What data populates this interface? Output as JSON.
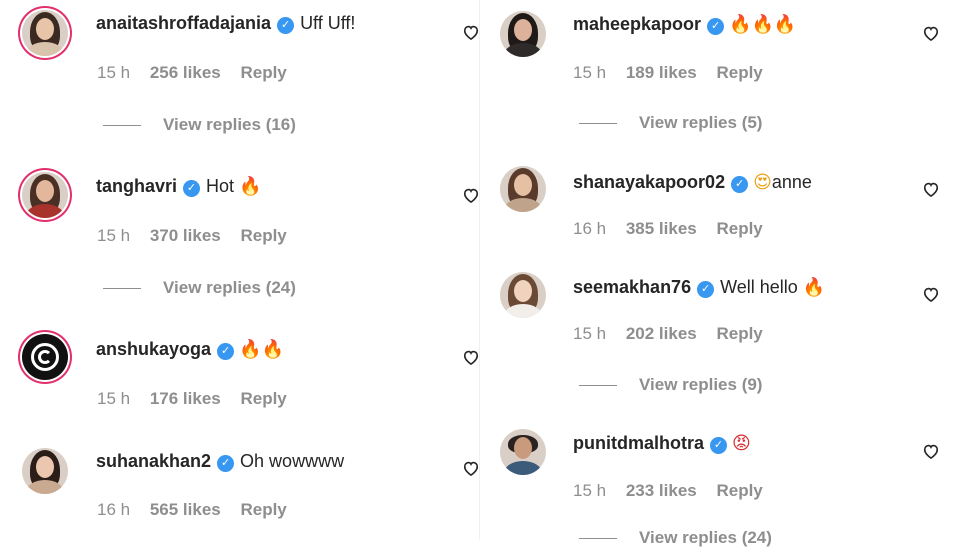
{
  "left": [
    {
      "username": "anaitashroffadajania",
      "text": "Uff Uff!",
      "emoji": "",
      "emoji_kind": "",
      "time": "15 h",
      "likes": "256 likes",
      "reply": "Reply",
      "view_replies": "View replies (16)"
    },
    {
      "username": "tanghavri",
      "text": "Hot",
      "emoji": "🔥",
      "emoji_kind": "fire",
      "time": "15 h",
      "likes": "370 likes",
      "reply": "Reply",
      "view_replies": "View replies (24)"
    },
    {
      "username": "anshukayoga",
      "text": "",
      "emoji": "🔥🔥",
      "emoji_kind": "fire",
      "time": "15 h",
      "likes": "176 likes",
      "reply": "Reply",
      "view_replies": ""
    },
    {
      "username": "suhanakhan2",
      "text": "Oh wowwww",
      "emoji": "",
      "emoji_kind": "",
      "time": "16 h",
      "likes": "565 likes",
      "reply": "Reply",
      "view_replies": ""
    }
  ],
  "right": [
    {
      "username": "maheepkapoor",
      "text": "",
      "emoji": "🔥🔥🔥",
      "emoji_kind": "fire",
      "time": "15 h",
      "likes": "189 likes",
      "reply": "Reply",
      "view_replies": "View replies (5)"
    },
    {
      "username": "shanayakapoor02",
      "text": "anne",
      "emoji": "😍",
      "emoji_kind": "heart-eyes",
      "time": "16 h",
      "likes": "385 likes",
      "reply": "Reply",
      "view_replies": ""
    },
    {
      "username": "seemakhan76",
      "text": "Well hello",
      "emoji": "🔥",
      "emoji_kind": "fire",
      "time": "15 h",
      "likes": "202 likes",
      "reply": "Reply",
      "view_replies": "View replies (9)"
    },
    {
      "username": "punitdmalhotra",
      "text": "",
      "emoji": "😡",
      "emoji_kind": "angry",
      "time": "15 h",
      "likes": "233 likes",
      "reply": "Reply",
      "view_replies": "View replies (24)"
    }
  ],
  "icons": {
    "heart": "heart-outline-icon",
    "verified": "verified-badge-icon"
  },
  "colors": {
    "verified": "#3897f0",
    "muted": "#8e8e8e",
    "text": "#262626",
    "story_ring": "#e1306c"
  }
}
